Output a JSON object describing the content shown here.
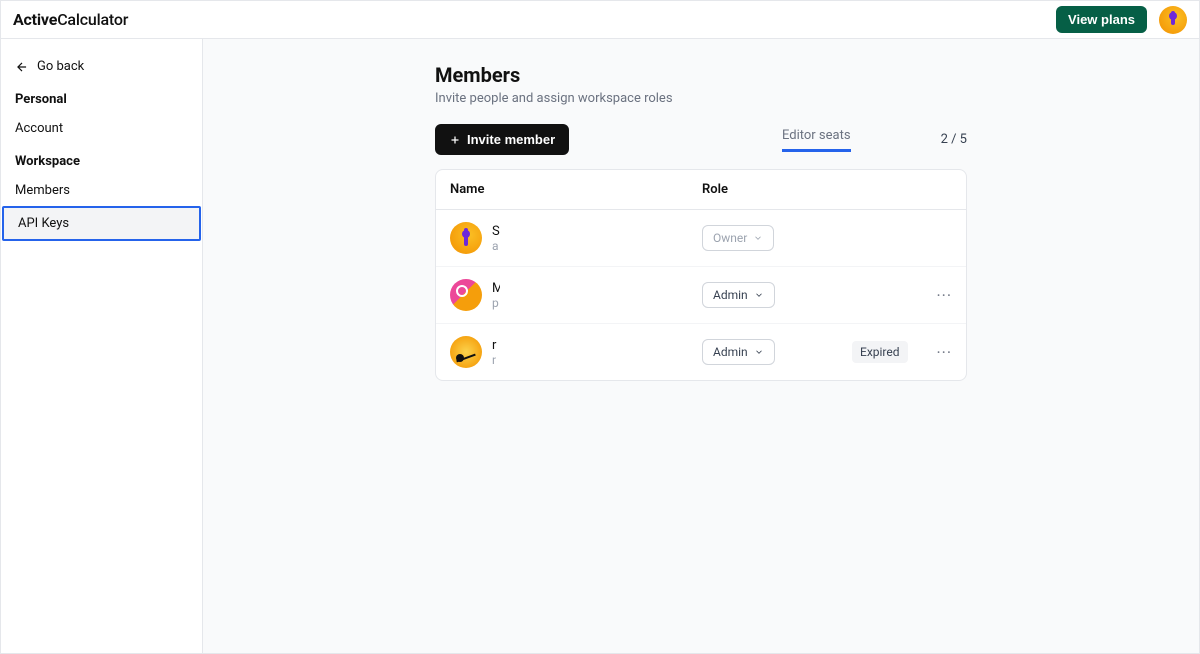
{
  "header": {
    "logo_bold": "Active",
    "logo_light": "Calculator",
    "view_plans": "View plans"
  },
  "sidebar": {
    "go_back": "Go back",
    "section_personal": "Personal",
    "item_account": "Account",
    "section_workspace": "Workspace",
    "item_members": "Members",
    "item_api_keys": "API Keys"
  },
  "page": {
    "title": "Members",
    "subtitle": "Invite people and assign workspace roles",
    "invite_button": "Invite member",
    "seats_label": "Editor seats",
    "seats_count": "2 / 5"
  },
  "table": {
    "col_name": "Name",
    "col_role": "Role"
  },
  "members": [
    {
      "initial": "S",
      "email_initial": "a",
      "role": "Owner",
      "disabled": true,
      "status": "",
      "has_menu": false
    },
    {
      "initial": "M",
      "email_initial": "p",
      "role": "Admin",
      "disabled": false,
      "status": "",
      "has_menu": true
    },
    {
      "initial": "r",
      "email_initial": "r",
      "role": "Admin",
      "disabled": false,
      "status": "Expired",
      "has_menu": true
    }
  ]
}
